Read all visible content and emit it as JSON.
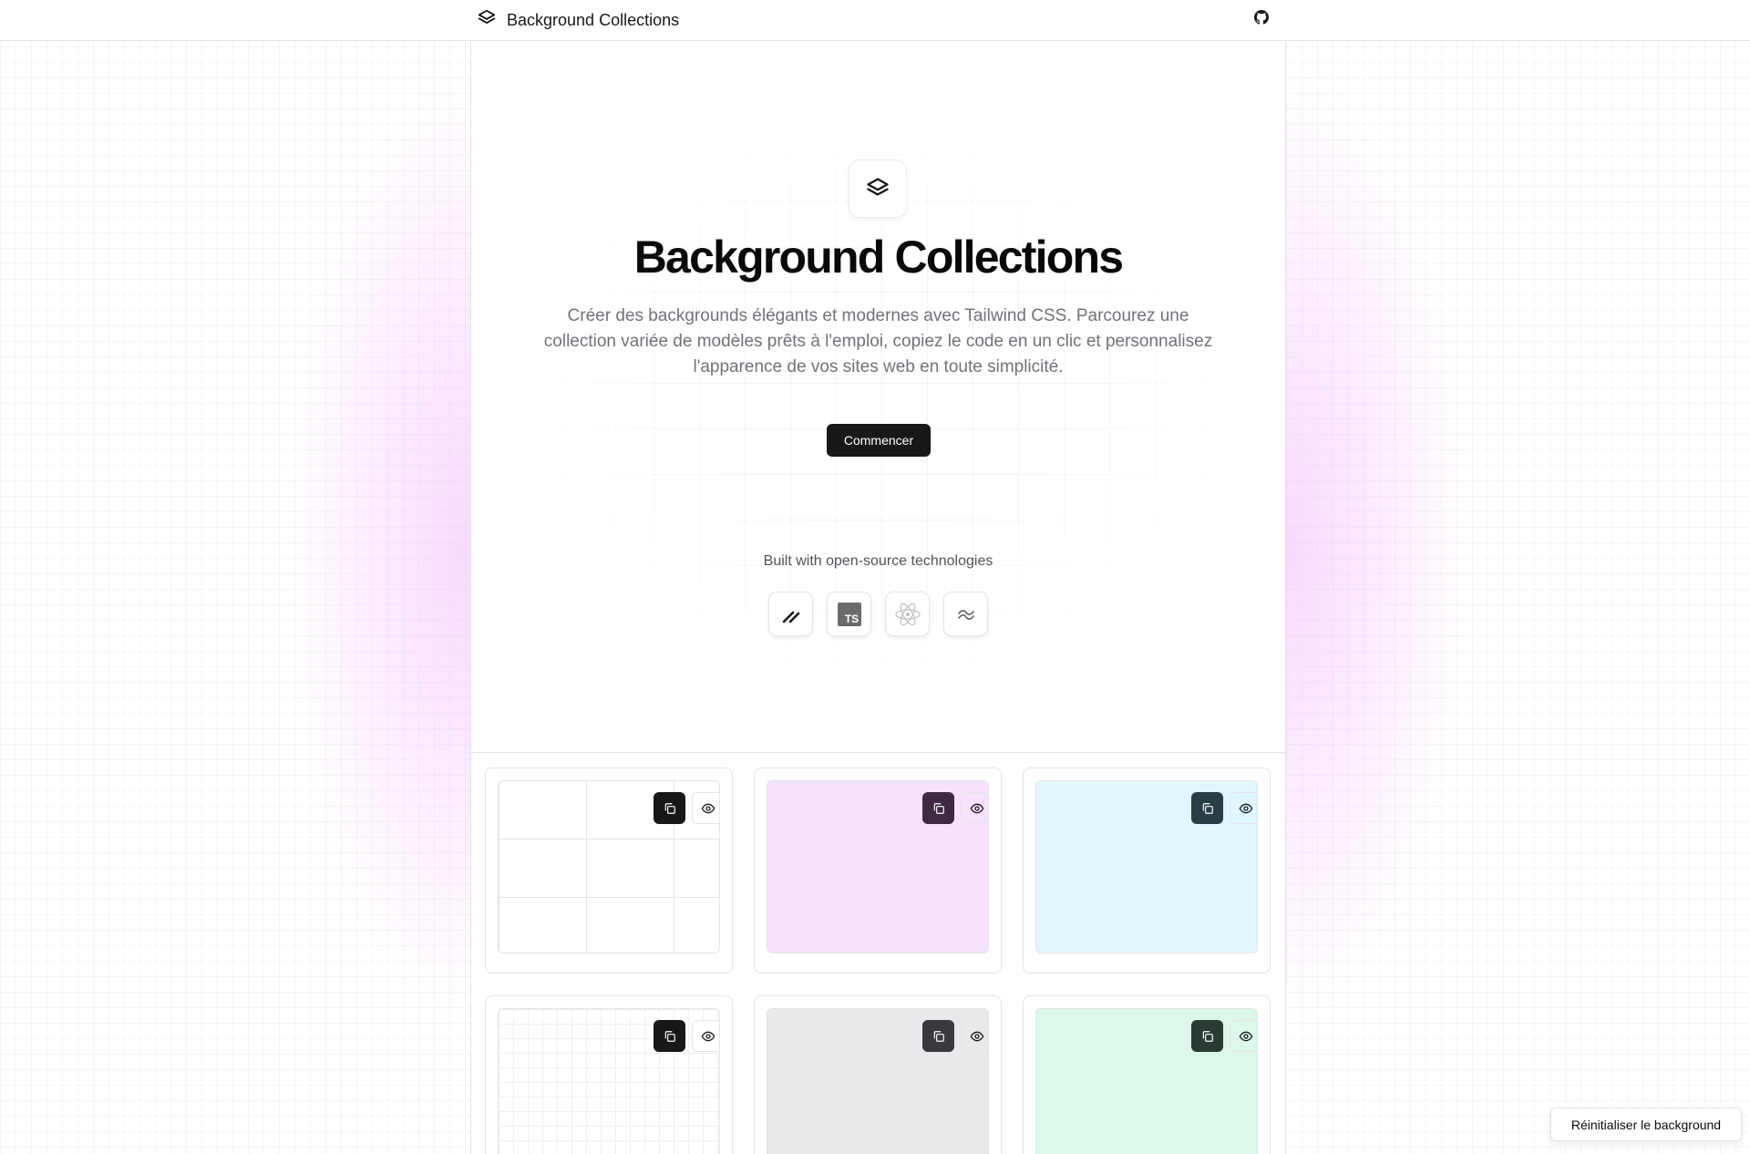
{
  "header": {
    "brand": "Background Collections",
    "logo_icon": "layers-icon",
    "github_icon": "github-icon"
  },
  "hero": {
    "icon": "layers-icon",
    "title": "Background Collections",
    "description": "Créer des backgrounds élégants et modernes avec Tailwind CSS. Parcourez une collection variée de modèles prêts à l'emploi, copiez le code en un clic et personnalisez l'apparence de vos sites web en toute simplicité.",
    "cta": "Commencer",
    "built_with": "Built with open-source technologies",
    "technologies": [
      "nextjs-icon",
      "typescript-icon",
      "react-icon",
      "tailwind-icon"
    ],
    "ts_label": "TS"
  },
  "cards": [
    {
      "name": "card-grid-large",
      "background": "#ffffff",
      "pattern": "grid-large",
      "copy_color": "#18181b",
      "view_color": "#ffffff"
    },
    {
      "name": "card-fuchsia",
      "background": "#f7e2fb",
      "pattern": "none",
      "copy_color": "#3f2a42",
      "view_color": "#f7e2fb"
    },
    {
      "name": "card-cyan",
      "background": "#e0f7fd",
      "pattern": "none",
      "copy_color": "#283e44",
      "view_color": "#e0f7fd"
    },
    {
      "name": "card-grid-small",
      "background": "#ffffff",
      "pattern": "grid-small",
      "copy_color": "#18181b",
      "view_color": "#ffffff"
    },
    {
      "name": "card-gray",
      "background": "#e9e9ec",
      "pattern": "none",
      "copy_color": "#3a3a3e",
      "view_color": "#e9e9ec"
    },
    {
      "name": "card-emerald",
      "background": "#dcf8ea",
      "pattern": "none",
      "copy_color": "#2a3b34",
      "view_color": "#dcf8ea"
    }
  ],
  "card_actions": {
    "copy_icon": "copy-icon",
    "view_icon": "eye-icon"
  },
  "reset_button": "Réinitialiser le background",
  "colors": {
    "accent": "#18181b",
    "glow": "#f0abfc",
    "muted_text": "#71717a",
    "border": "#e4e4e7"
  }
}
